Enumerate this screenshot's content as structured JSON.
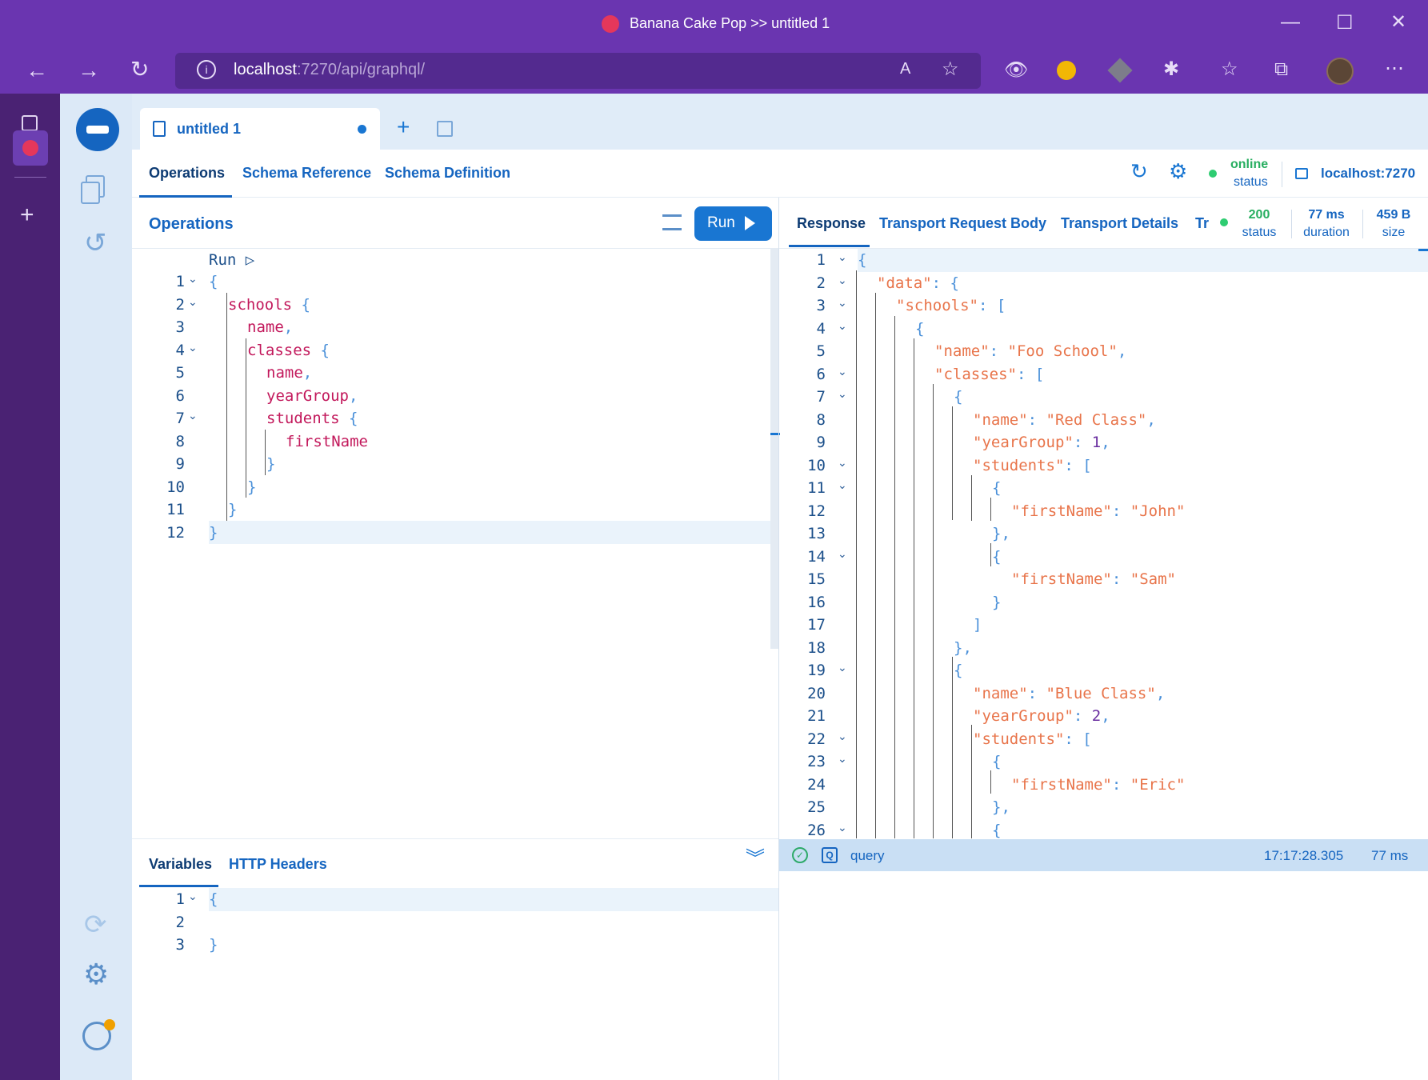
{
  "browser": {
    "title": "Banana Cake Pop >> untitled 1",
    "url_host": "localhost",
    "url_rest": ":7270/api/graphql/"
  },
  "doc_tab": {
    "label": "untitled 1"
  },
  "nav_tabs": [
    "Operations",
    "Schema Reference",
    "Schema Definition"
  ],
  "connection": {
    "status_value": "online",
    "status_label": "status",
    "endpoint": "localhost:7270"
  },
  "operations": {
    "title": "Operations",
    "run_label": "Run",
    "codelens": "Run ▷",
    "line_numbers": [
      "1",
      "2",
      "3",
      "4",
      "5",
      "6",
      "7",
      "8",
      "9",
      "10",
      "11",
      "12"
    ],
    "lines": [
      "{",
      "schools {",
      "name,",
      "classes {",
      "name,",
      "yearGroup,",
      "students {",
      "firstName",
      "}",
      "}",
      "}",
      "}"
    ]
  },
  "bottom": {
    "tabs": [
      "Variables",
      "HTTP Headers"
    ],
    "line_numbers": [
      "1",
      "2",
      "3"
    ],
    "lines": [
      "{",
      "",
      "}"
    ]
  },
  "response": {
    "tabs": [
      "Response",
      "Transport Request Body",
      "Transport Details",
      "Tr"
    ],
    "status_value": "200",
    "status_label": "status",
    "duration_value": "77 ms",
    "duration_label": "duration",
    "size_value": "459 B",
    "size_label": "size",
    "line_numbers": [
      "1",
      "2",
      "3",
      "4",
      "5",
      "6",
      "7",
      "8",
      "9",
      "10",
      "11",
      "12",
      "13",
      "14",
      "15",
      "16",
      "17",
      "18",
      "19",
      "20",
      "21",
      "22",
      "23",
      "24",
      "25",
      "26"
    ],
    "lines": [
      "{",
      "\"data\": {",
      "\"schools\": [",
      "{",
      "\"name\": \"Foo School\",",
      "\"classes\": [",
      "{",
      "\"name\": \"Red Class\",",
      "\"yearGroup\": 1,",
      "\"students\": [",
      "{",
      "\"firstName\": \"John\"",
      "},",
      "{",
      "\"firstName\": \"Sam\"",
      "}",
      "]",
      "},",
      "{",
      "\"name\": \"Blue Class\",",
      "\"yearGroup\": 2,",
      "\"students\": [",
      "{",
      "\"firstName\": \"Eric\"",
      "},",
      "{"
    ]
  },
  "history": {
    "type": "query",
    "time": "17:17:28.305",
    "duration": "77 ms"
  },
  "colors": {
    "accent": "#1565c0",
    "online": "#2ecc71",
    "chrome": "#6a35b0"
  }
}
